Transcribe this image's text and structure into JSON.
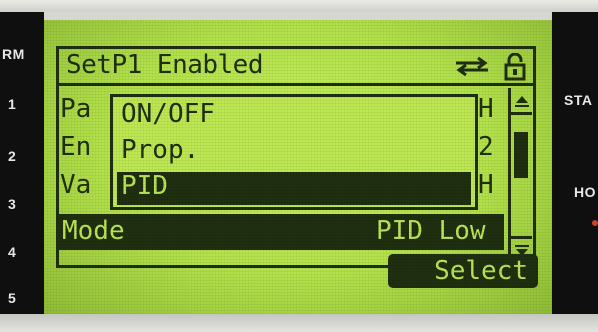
{
  "screen": {
    "title": "SetP1 Enabled",
    "background_rows": [
      {
        "label": "Pa",
        "right": "H"
      },
      {
        "label": "En",
        "right": "2"
      },
      {
        "label": "Va",
        "right": "H"
      }
    ],
    "mode": {
      "label": "Mode",
      "value": "PID Low"
    },
    "dropdown": {
      "options": [
        "ON/OFF",
        "Prop.",
        "PID"
      ],
      "selected": "PID"
    },
    "select_button": "Select"
  },
  "side_left_labels": [
    "RM",
    "1",
    "2",
    "3",
    "4",
    "5"
  ],
  "side_right_labels": [
    "STA",
    "HO"
  ],
  "icons": [
    "swap-arrows-icon",
    "lock-icon",
    "scroll-up-icon",
    "scroll-down-icon"
  ],
  "colors": {
    "lcd": "#b8e44e",
    "pixel": "#1f2f10"
  }
}
